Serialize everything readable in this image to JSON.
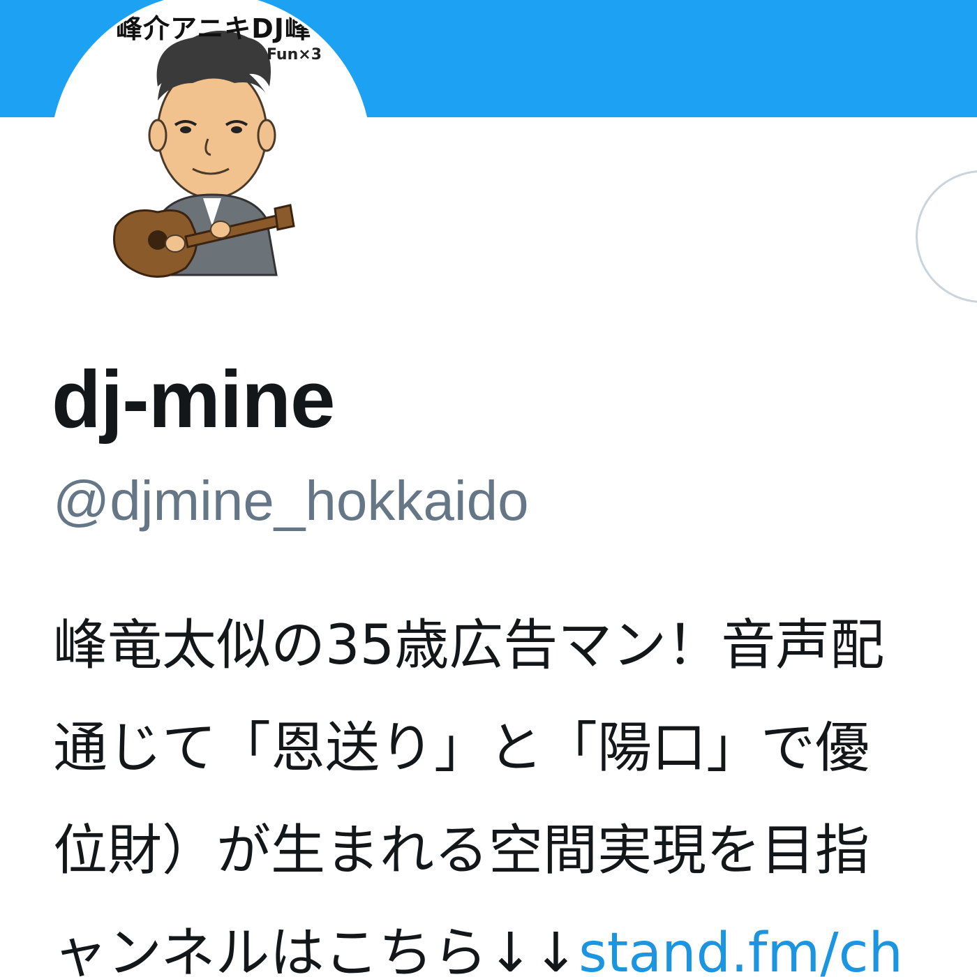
{
  "colors": {
    "banner": "#1da1f2",
    "display_name": "#14171a",
    "handle": "#657786",
    "link": "#1b95e0"
  },
  "avatar": {
    "icon": "avatar-icon",
    "caption_top": "峰介アニキDJ峰",
    "caption_sub": "Fun×3"
  },
  "profile": {
    "display_name": "dj-mine",
    "handle": "@djmine_hokkaido"
  },
  "bio": {
    "line1": "峰竜太似の35歳広告マン！音声配",
    "line2": "通じて「恩送り」と「陽口」で優",
    "line3": "位財）が生まれる空間実現を目指",
    "line4_text": "ャンネルはこちら↓↓",
    "line4_link": "stand.fm/ch"
  }
}
